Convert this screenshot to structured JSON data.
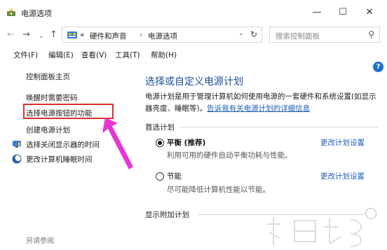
{
  "window": {
    "title": "电源选项",
    "minimize": "—",
    "maximize": "☐",
    "close": "✕"
  },
  "addressbar": {
    "back": "←",
    "forward": "→",
    "history_dropdown": "⌄",
    "up": "↑",
    "overflow": "«",
    "crumbs": [
      "硬件和声音",
      "电源选项"
    ],
    "separator": "›",
    "dropdown": "⌄",
    "refresh": "↻"
  },
  "search": {
    "placeholder": "搜索控制面板",
    "icon": "⚲"
  },
  "menubar": {
    "items": [
      "文件(F)",
      "编辑(E)",
      "查看(V)",
      "工具(T)",
      "帮助(H)"
    ]
  },
  "sidebar": {
    "home": "控制面板主页",
    "links": [
      "唤醒时需要密码",
      "选择电源按钮的功能",
      "创建电源计划",
      "选择关闭显示器的时间",
      "更改计算机睡眠时间"
    ],
    "see_also": "另请参阅"
  },
  "main": {
    "help": "?",
    "heading": "选择或自定义电源计划",
    "desc_line1": "电源计划是用于管理计算机如何使用电源的一套硬件和系统设置(如显示",
    "desc_line2_prefix": "器亮度、睡眠等)。",
    "desc_link": "告诉我有关电源计划的详细信息",
    "preferred_title": "首选计划",
    "plans": [
      {
        "name": "平衡 (推荐)",
        "desc": "利用可用的硬件自动平衡功耗与性能。",
        "link": "更改计划设置",
        "selected": true
      },
      {
        "name": "节能",
        "desc": "尽可能降低计算机性能以节能。",
        "link": "更改计划设置",
        "selected": false
      }
    ],
    "additional_title": "显示附加计划"
  },
  "colors": {
    "heading": "#1b4e96",
    "link": "#1d5fb5",
    "highlight_border": "#d9302c",
    "arrow": "#e636d6",
    "help_icon": "#1e6fc8"
  }
}
